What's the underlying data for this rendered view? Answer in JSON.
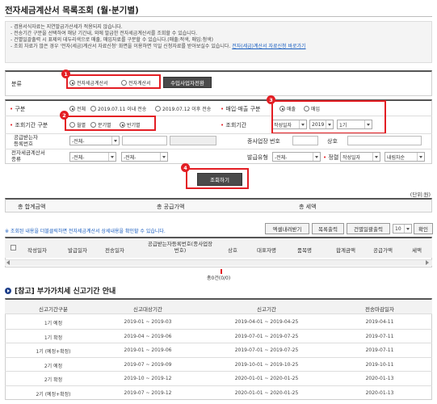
{
  "page": {
    "title": "전자세금계산서 목록조회 (월·분기별)"
  },
  "notice": {
    "lines": [
      "- 겸용서식자료는 지연발급가산세가 적용되지 않습니다.",
      "- 전송기간 구분을 선택하여 해당 기간내, 외에 발급한 전자세금계산서를 조회할 수 있습니다.",
      "- 건별일괄출력 시 표제의 데두리색으로 매출, 매입자료를 구분할 수 있습니다.(매출:적색, 매입:청색)",
      "- 조회 자료가 많은 경우 '전자(세금)계산서 자료신청' 화면을 이용하면 익일 신청자료를 받아보실수 있습니다."
    ],
    "link": "전자(세금)계산서 자료신청 바로가기"
  },
  "filter_top": {
    "label": "분류",
    "option1": "전자세금계산서",
    "option2": "전자계산서",
    "button": "수입사업자전환"
  },
  "filters": {
    "type_label": "구분",
    "type_opt1": "전체",
    "type_opt2": "2019.07.11 이내 전송",
    "type_opt3": "2019.07.12 이후 전송",
    "trade_label": "매입·매출 구분",
    "trade_opt1": "매출",
    "trade_opt2": "매입",
    "period_label": "조회기간 구분",
    "period_opt1": "월별",
    "period_opt2": "분기별",
    "period_opt3": "반기별",
    "range_label": "조회기간",
    "range_sel1": "작성일자",
    "range_sel2": "2019",
    "range_sel3": "1기",
    "supplier_label1": "공급받는자",
    "supplier_label2": "등록번호",
    "supplier_sel": "-전체-",
    "branch_label": "종사업장 번호",
    "company_label": "상호",
    "kind_label1": "전자세금계산서",
    "kind_label2": "종류",
    "kind_sel1": "-전체-",
    "kind_sel2": "-전체-",
    "issue_label": "발급유형",
    "issue_sel": "-전체-",
    "sort_label": "정렬",
    "sort_sel1": "작성일자",
    "sort_sel2": "내림차순"
  },
  "search_button": "조회하기",
  "badges": [
    "1",
    "2",
    "3",
    "4"
  ],
  "unit": "(단위:원)",
  "totals": {
    "total_amount": "총 합계금액",
    "supply_amount": "총 공급가액",
    "tax_amount": "총 세액"
  },
  "list_notice": "※ 조회된 내용을 더블클릭하면 전자세금계산서 상세내용을 확인할 수 있습니다.",
  "toolbar": {
    "excel": "엑셀내려받기",
    "print_list": "목록출력",
    "print_batch": "건별일괄출력",
    "page_size": "10",
    "confirm": "확인"
  },
  "table": {
    "columns": [
      "작성일자",
      "발급일자",
      "전송일자",
      "공급받는자등록번호(종사업장 번호)",
      "상호",
      "대표자명",
      "품목명",
      "합계금액",
      "공급가액",
      "세액"
    ],
    "empty": "총0건(0/0)"
  },
  "ref_section": {
    "title": "[참고] 부가가치세 신고기간 안내",
    "columns": [
      "신고기간구분",
      "신고대상기간",
      "신고기간",
      "전송마감일자"
    ],
    "rows": [
      [
        "1기 예정",
        "2019-01 ~ 2019-03",
        "2019-04-01 ~ 2019-04-25",
        "2019-04-11"
      ],
      [
        "1기 확정",
        "2019-04 ~ 2019-06",
        "2019-07-01 ~ 2019-07-25",
        "2019-07-11"
      ],
      [
        "1기 (예정+확정)",
        "2019-01 ~ 2019-06",
        "2019-07-01 ~ 2019-07-25",
        "2019-07-11"
      ],
      [
        "2기 예정",
        "2019-07 ~ 2019-09",
        "2019-10-01 ~ 2019-10-25",
        "2019-10-11"
      ],
      [
        "2기 확정",
        "2019-10 ~ 2019-12",
        "2020-01-01 ~ 2020-01-25",
        "2020-01-13"
      ],
      [
        "2기 (예정+확정)",
        "2019-07 ~ 2019-12",
        "2020-01-01 ~ 2020-01-25",
        "2020-01-13"
      ]
    ]
  },
  "colors": {
    "highlight": "#e31e24",
    "dark_button": "#4a4a4a",
    "link": "#1a5ec0",
    "section_icon": "#1e3f8a"
  }
}
